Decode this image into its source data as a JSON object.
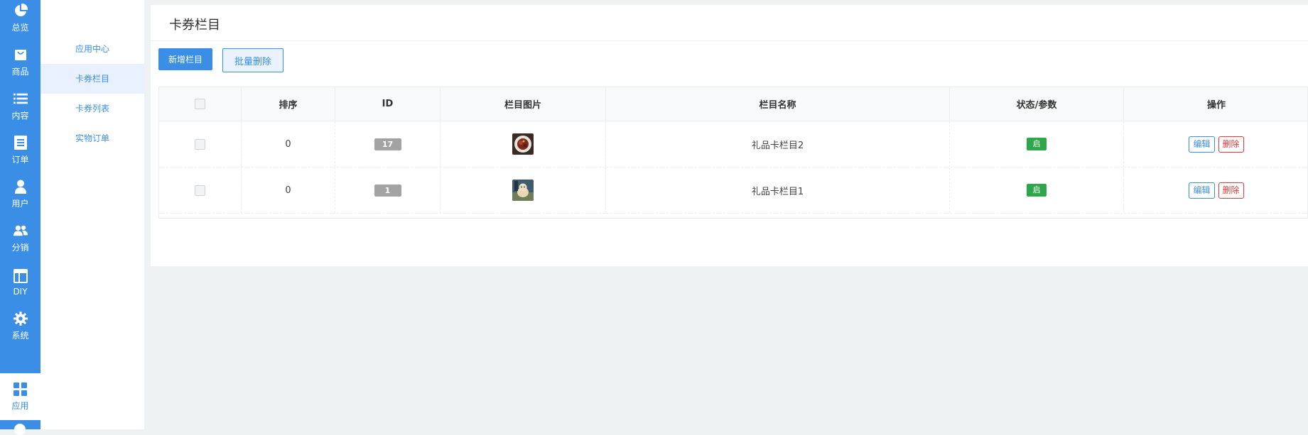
{
  "primary_nav": [
    {
      "label": "总览",
      "icon": "pie-chart-icon"
    },
    {
      "label": "商品",
      "icon": "shopping-bag-icon"
    },
    {
      "label": "内容",
      "icon": "list-icon"
    },
    {
      "label": "订单",
      "icon": "document-icon"
    },
    {
      "label": "用户",
      "icon": "user-icon"
    },
    {
      "label": "分销",
      "icon": "users-icon"
    },
    {
      "label": "DIY",
      "icon": "layout-icon"
    },
    {
      "label": "系统",
      "icon": "gear-icon"
    },
    {
      "label": "应用",
      "icon": "grid-icon",
      "active": true
    }
  ],
  "secondary_nav": [
    {
      "label": "应用中心"
    },
    {
      "label": "卡券栏目",
      "active": true
    },
    {
      "label": "卡券列表"
    },
    {
      "label": "实物订单"
    }
  ],
  "page": {
    "title": "卡券栏目",
    "add_button": "新增栏目",
    "batch_delete_button": "批量删除"
  },
  "table": {
    "headers": [
      "排序",
      "ID",
      "栏目图片",
      "栏目名称",
      "状态/参数",
      "操作"
    ],
    "rows": [
      {
        "sort": "0",
        "id": "17",
        "name": "礼品卡栏目2",
        "status": "启",
        "edit": "编辑",
        "delete": "删除",
        "image": "food-thumbnail"
      },
      {
        "sort": "0",
        "id": "1",
        "name": "礼品卡栏目1",
        "status": "启",
        "edit": "编辑",
        "delete": "删除",
        "image": "dog-thumbnail"
      }
    ]
  },
  "colors": {
    "accent": "#3a8ee6",
    "success": "#2ea64a",
    "danger": "#e23a3a",
    "id_badge": "#a3a3a3"
  }
}
